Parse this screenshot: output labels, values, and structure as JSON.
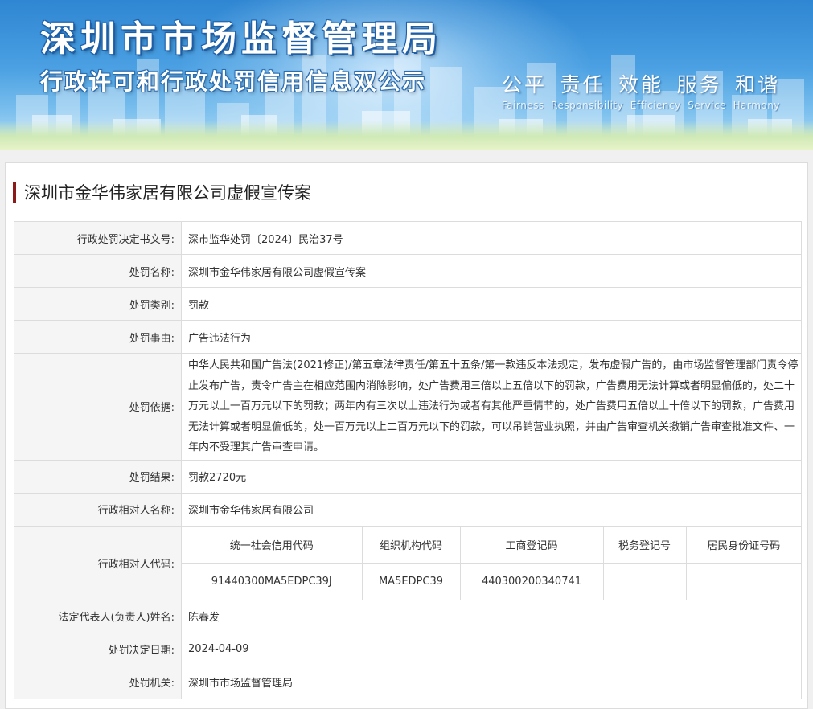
{
  "banner": {
    "title": "深圳市市场监督管理局",
    "subtitle": "行政许可和行政处罚信用信息双公示",
    "values_cn": [
      "公平",
      "责任",
      "效能",
      "服务",
      "和谐"
    ],
    "values_en": [
      "Fairness",
      "Responsibility",
      "Efficiency",
      "Service",
      "Harmony"
    ]
  },
  "case_title": "深圳市金华伟家居有限公司虚假宣传案",
  "fields": {
    "doc_no": {
      "label": "行政处罚决定书文号:",
      "value": "深市监华处罚〔2024〕民治37号"
    },
    "name": {
      "label": "处罚名称:",
      "value": "深圳市金华伟家居有限公司虚假宣传案"
    },
    "category": {
      "label": "处罚类别:",
      "value": "罚款"
    },
    "reason": {
      "label": "处罚事由:",
      "value": "广告违法行为"
    },
    "basis": {
      "label": "处罚依据:",
      "value": "中华人民共和国广告法(2021修正)/第五章法律责任/第五十五条/第一款违反本法规定，发布虚假广告的，由市场监督管理部门责令停止发布广告，责令广告主在相应范围内消除影响，处广告费用三倍以上五倍以下的罚款，广告费用无法计算或者明显偏低的，处二十万元以上一百万元以下的罚款；两年内有三次以上违法行为或者有其他严重情节的，处广告费用五倍以上十倍以下的罚款，广告费用无法计算或者明显偏低的，处一百万元以上二百万元以下的罚款，可以吊销营业执照，并由广告审查机关撤销广告审查批准文件、一年内不受理其广告审查申请。"
    },
    "result": {
      "label": "处罚结果:",
      "value": "罚款2720元"
    },
    "party_name": {
      "label": "行政相对人名称:",
      "value": "深圳市金华伟家居有限公司"
    },
    "party_code": {
      "label": "行政相对人代码:",
      "headers": [
        "统一社会信用代码",
        "组织机构代码",
        "工商登记码",
        "税务登记号",
        "居民身份证号码"
      ],
      "values": [
        "91440300MA5EDPC39J",
        "MA5EDPC39",
        "440300200340741",
        "",
        ""
      ]
    },
    "legal_rep": {
      "label": "法定代表人(负责人)姓名:",
      "value": "陈春发"
    },
    "decision_date": {
      "label": "处罚决定日期:",
      "value": "2024-04-09"
    },
    "authority": {
      "label": "处罚机关:",
      "value": "深圳市市场监督管理局"
    }
  }
}
